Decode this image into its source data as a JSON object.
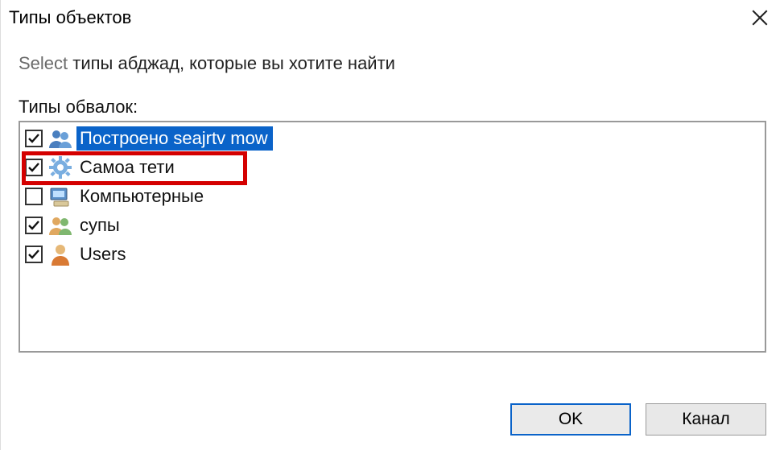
{
  "dialog": {
    "title": "Типы объектов",
    "instruction_select": "Select",
    "instruction_rest": " типы абджад, которые вы хотите найти",
    "list_label": "Типы обвалок:",
    "items": [
      {
        "label": "Построено seajrtv mow",
        "checked": true,
        "selected": true,
        "icon": "people-icon"
      },
      {
        "label": "Самоа тети",
        "checked": true,
        "selected": false,
        "icon": "gear-icon"
      },
      {
        "label": "Компьютерные",
        "checked": false,
        "selected": false,
        "icon": "computer-icon"
      },
      {
        "label": "супы",
        "checked": true,
        "selected": false,
        "icon": "group-icon"
      },
      {
        "label": "Users",
        "checked": true,
        "selected": false,
        "icon": "user-icon"
      }
    ],
    "ok_label": "OK",
    "cancel_label": "Канал"
  },
  "highlight_row_index": 1
}
